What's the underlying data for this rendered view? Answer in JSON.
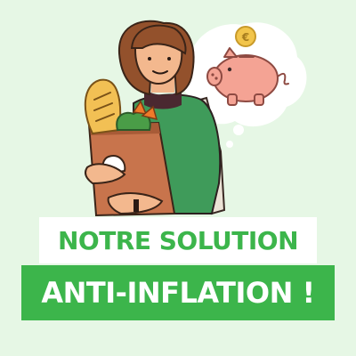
{
  "headline": {
    "line1": "NOTRE SOLUTION",
    "line2": "ANTI-INFLATION !"
  },
  "icons": {
    "coin_symbol": "€"
  },
  "colors": {
    "background": "#e6f7e5",
    "brand_green": "#3cb54b",
    "white": "#ffffff"
  }
}
